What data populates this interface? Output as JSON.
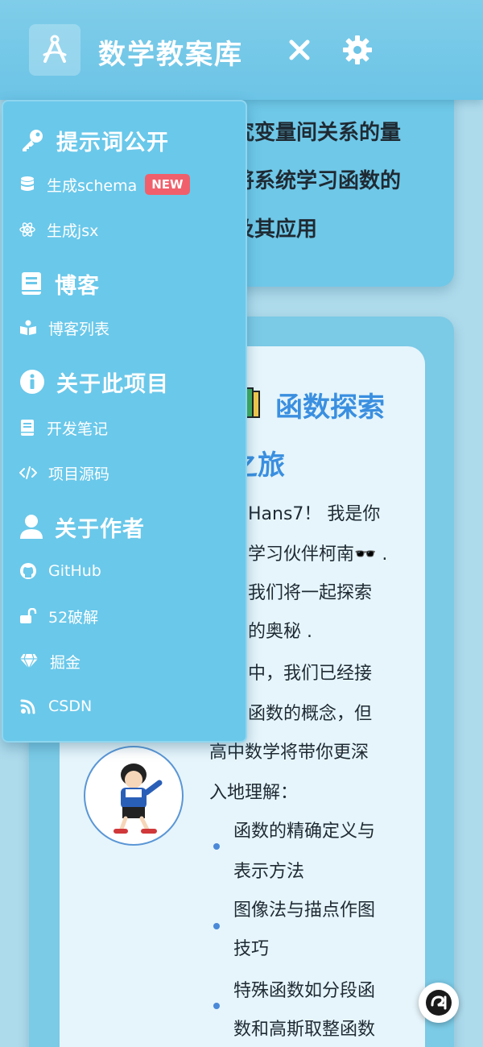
{
  "header": {
    "title": "数学教案库",
    "logo_icon": "compass-a-icon",
    "close_icon": "close-icon",
    "settings_icon": "gear-icon"
  },
  "card1": {
    "lines": [
      "究变量间关系的量",
      "将系统学习函数的",
      "及其应用"
    ]
  },
  "article": {
    "title_line1": "函数探索",
    "title_line2": "之旅",
    "paragraph": [
      "Hans7！ 我是你",
      "学习伙伴柯南🕶️ .",
      "我们将一起探索",
      "的奥秘 .",
      "中，我们已经接",
      "函数的概念，但",
      "高中数学将带你更深",
      "入地理解："
    ],
    "list": [
      [
        "函数的精确定义与",
        "表示方法"
      ],
      [
        "图像法与描点作图",
        "技巧"
      ],
      [
        "特殊函数如分段函",
        "数和高斯取整函数"
      ]
    ]
  },
  "menu": {
    "sections": [
      {
        "label": "提示词公开",
        "icon": "key-icon",
        "items": [
          {
            "label": "生成schema",
            "icon": "database-icon",
            "badge": "NEW"
          },
          {
            "label": "生成jsx",
            "icon": "react-atom-icon"
          }
        ]
      },
      {
        "label": "博客",
        "icon": "book-icon",
        "items": [
          {
            "label": "博客列表",
            "icon": "reader-icon"
          }
        ]
      },
      {
        "label": "关于此项目",
        "icon": "info-icon",
        "items": [
          {
            "label": "开发笔记",
            "icon": "notebook-icon"
          },
          {
            "label": "项目源码",
            "icon": "code-icon"
          }
        ]
      },
      {
        "label": "关于作者",
        "icon": "user-icon",
        "items": [
          {
            "label": "GitHub",
            "icon": "github-icon"
          },
          {
            "label": "52破解",
            "icon": "unlock-icon"
          },
          {
            "label": "掘金",
            "icon": "gem-icon"
          },
          {
            "label": "CSDN",
            "icon": "csdn-icon"
          }
        ]
      }
    ]
  },
  "float_button": {
    "icon": "scroll-indicator-icon"
  },
  "colors": {
    "header": "#6cc4e6",
    "menu": "#6ac8ea",
    "accent": "#3a8fe0",
    "badge": "#f0606c"
  }
}
